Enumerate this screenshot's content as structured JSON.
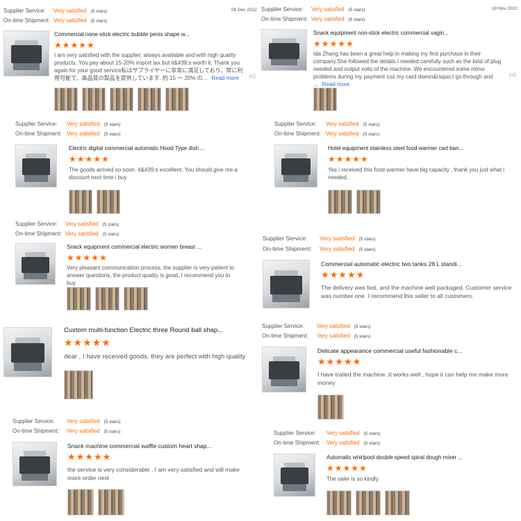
{
  "labels": {
    "supplier_service": "Supplier Service:",
    "on_time_shipment": "On-time Shipment:",
    "very_satisfied": "Very satisfied",
    "five_stars": "(5 stars)",
    "read_more": "Read more",
    "stars": "★★★★★",
    "like_icon": "thumbs-up-icon"
  },
  "reviews": [
    {
      "date": "06 Dec 2022",
      "title": "Commercial none-stick electric bubble penis shape w...",
      "body": "I am very satisfied with the supplier, always available and with high quality products.  You pay about 15-20% import tax but it&#39;s worth it. Thank you again for your good service私はサプライヤーに非常に満足しており、常に利用可能で、高品質の製品を提供しています. 約 15 ～ 20% の..."
    },
    {
      "date": "18 Nov 2022",
      "title": "Snack equipment non-stick electric commercial vagin...",
      "body": "Ida Zhang has been a great help in making my first purchase in their company.She followed the details I needed carefully such as the kind of plug needed and output volts of the machine. We encountered some minor problems during my payment coz my card doesn&rsquo;t go through and ..."
    },
    {
      "title": "Electric digital commercial automatic Hood Type dish ...",
      "body": "The goods arrived so soon. It&#39;s excellent. You should give me a discount next time i buy"
    },
    {
      "title": "Hotel equipment stainless steel food warmer cart ban...",
      "body": "Yes i received this food warmer have big capacity , thank you  just what i needed."
    },
    {
      "title": "Snack equipment commercial electric women breast ...",
      "body": "Very pleasant communication process, the supplier is very patient to answer questions, the product quality is good, I recommend you to buy"
    },
    {
      "title": "Commercial automatic electric two tanks 28 L standi...",
      "body": "The delivery was fast, and the machine well packaged. Customer service was number one. I recommend this seller to all customers."
    },
    {
      "title": "Custom multi-function Electric three Round ball shap...",
      "body": "dear , I have received goods. they are perfect with high quality"
    },
    {
      "title": "Delicate appearance commercial useful fashionable c...",
      "body": "I have trailed the machine ,It works well , hope it can help me make more money"
    },
    {
      "title": "Snack machine commercial waffle custom heart shap...",
      "body": "the service is very considerable . I am very satisfied and will make more order next"
    },
    {
      "title": "Automatic whirlpool double speed spiral dough mixer ...",
      "body": "The saler is so kindly."
    }
  ]
}
